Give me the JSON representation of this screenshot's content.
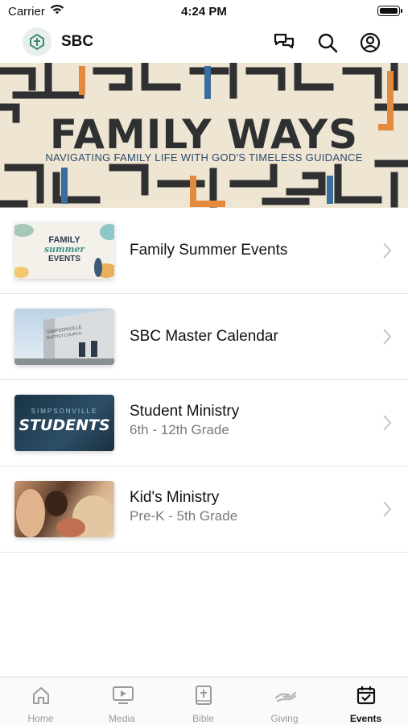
{
  "status_bar": {
    "carrier": "Carrier",
    "time": "4:24 PM"
  },
  "header": {
    "title": "SBC"
  },
  "banner": {
    "title": "FAMILY WAYS",
    "subtitle": "NAVIGATING FAMILY LIFE WITH GOD'S TIMELESS GUIDANCE"
  },
  "list": [
    {
      "title": "Family Summer Events",
      "subtitle": "",
      "thumb_text": [
        "FAMILY",
        "summer",
        "EVENTS"
      ]
    },
    {
      "title": "SBC Master Calendar",
      "subtitle": "",
      "thumb_text": [
        "SIMPSONVILLE",
        "BAPTIST CHURCH"
      ]
    },
    {
      "title": "Student Ministry",
      "subtitle": "6th - 12th Grade",
      "thumb_text": [
        "SIMPSONVILLE",
        "STUDENTS"
      ]
    },
    {
      "title": "Kid's Ministry",
      "subtitle": "Pre-K - 5th Grade",
      "thumb_text": []
    }
  ],
  "tabs": [
    {
      "label": "Home",
      "icon": "home-icon"
    },
    {
      "label": "Media",
      "icon": "media-icon"
    },
    {
      "label": "Bible",
      "icon": "bible-icon"
    },
    {
      "label": "Giving",
      "icon": "giving-icon"
    },
    {
      "label": "Events",
      "icon": "events-icon"
    }
  ],
  "colors": {
    "accent_orange": "#e48a3c",
    "accent_blue": "#3a6e9c",
    "banner_bg": "#efe5d3",
    "maze_dark": "#2f3032"
  }
}
